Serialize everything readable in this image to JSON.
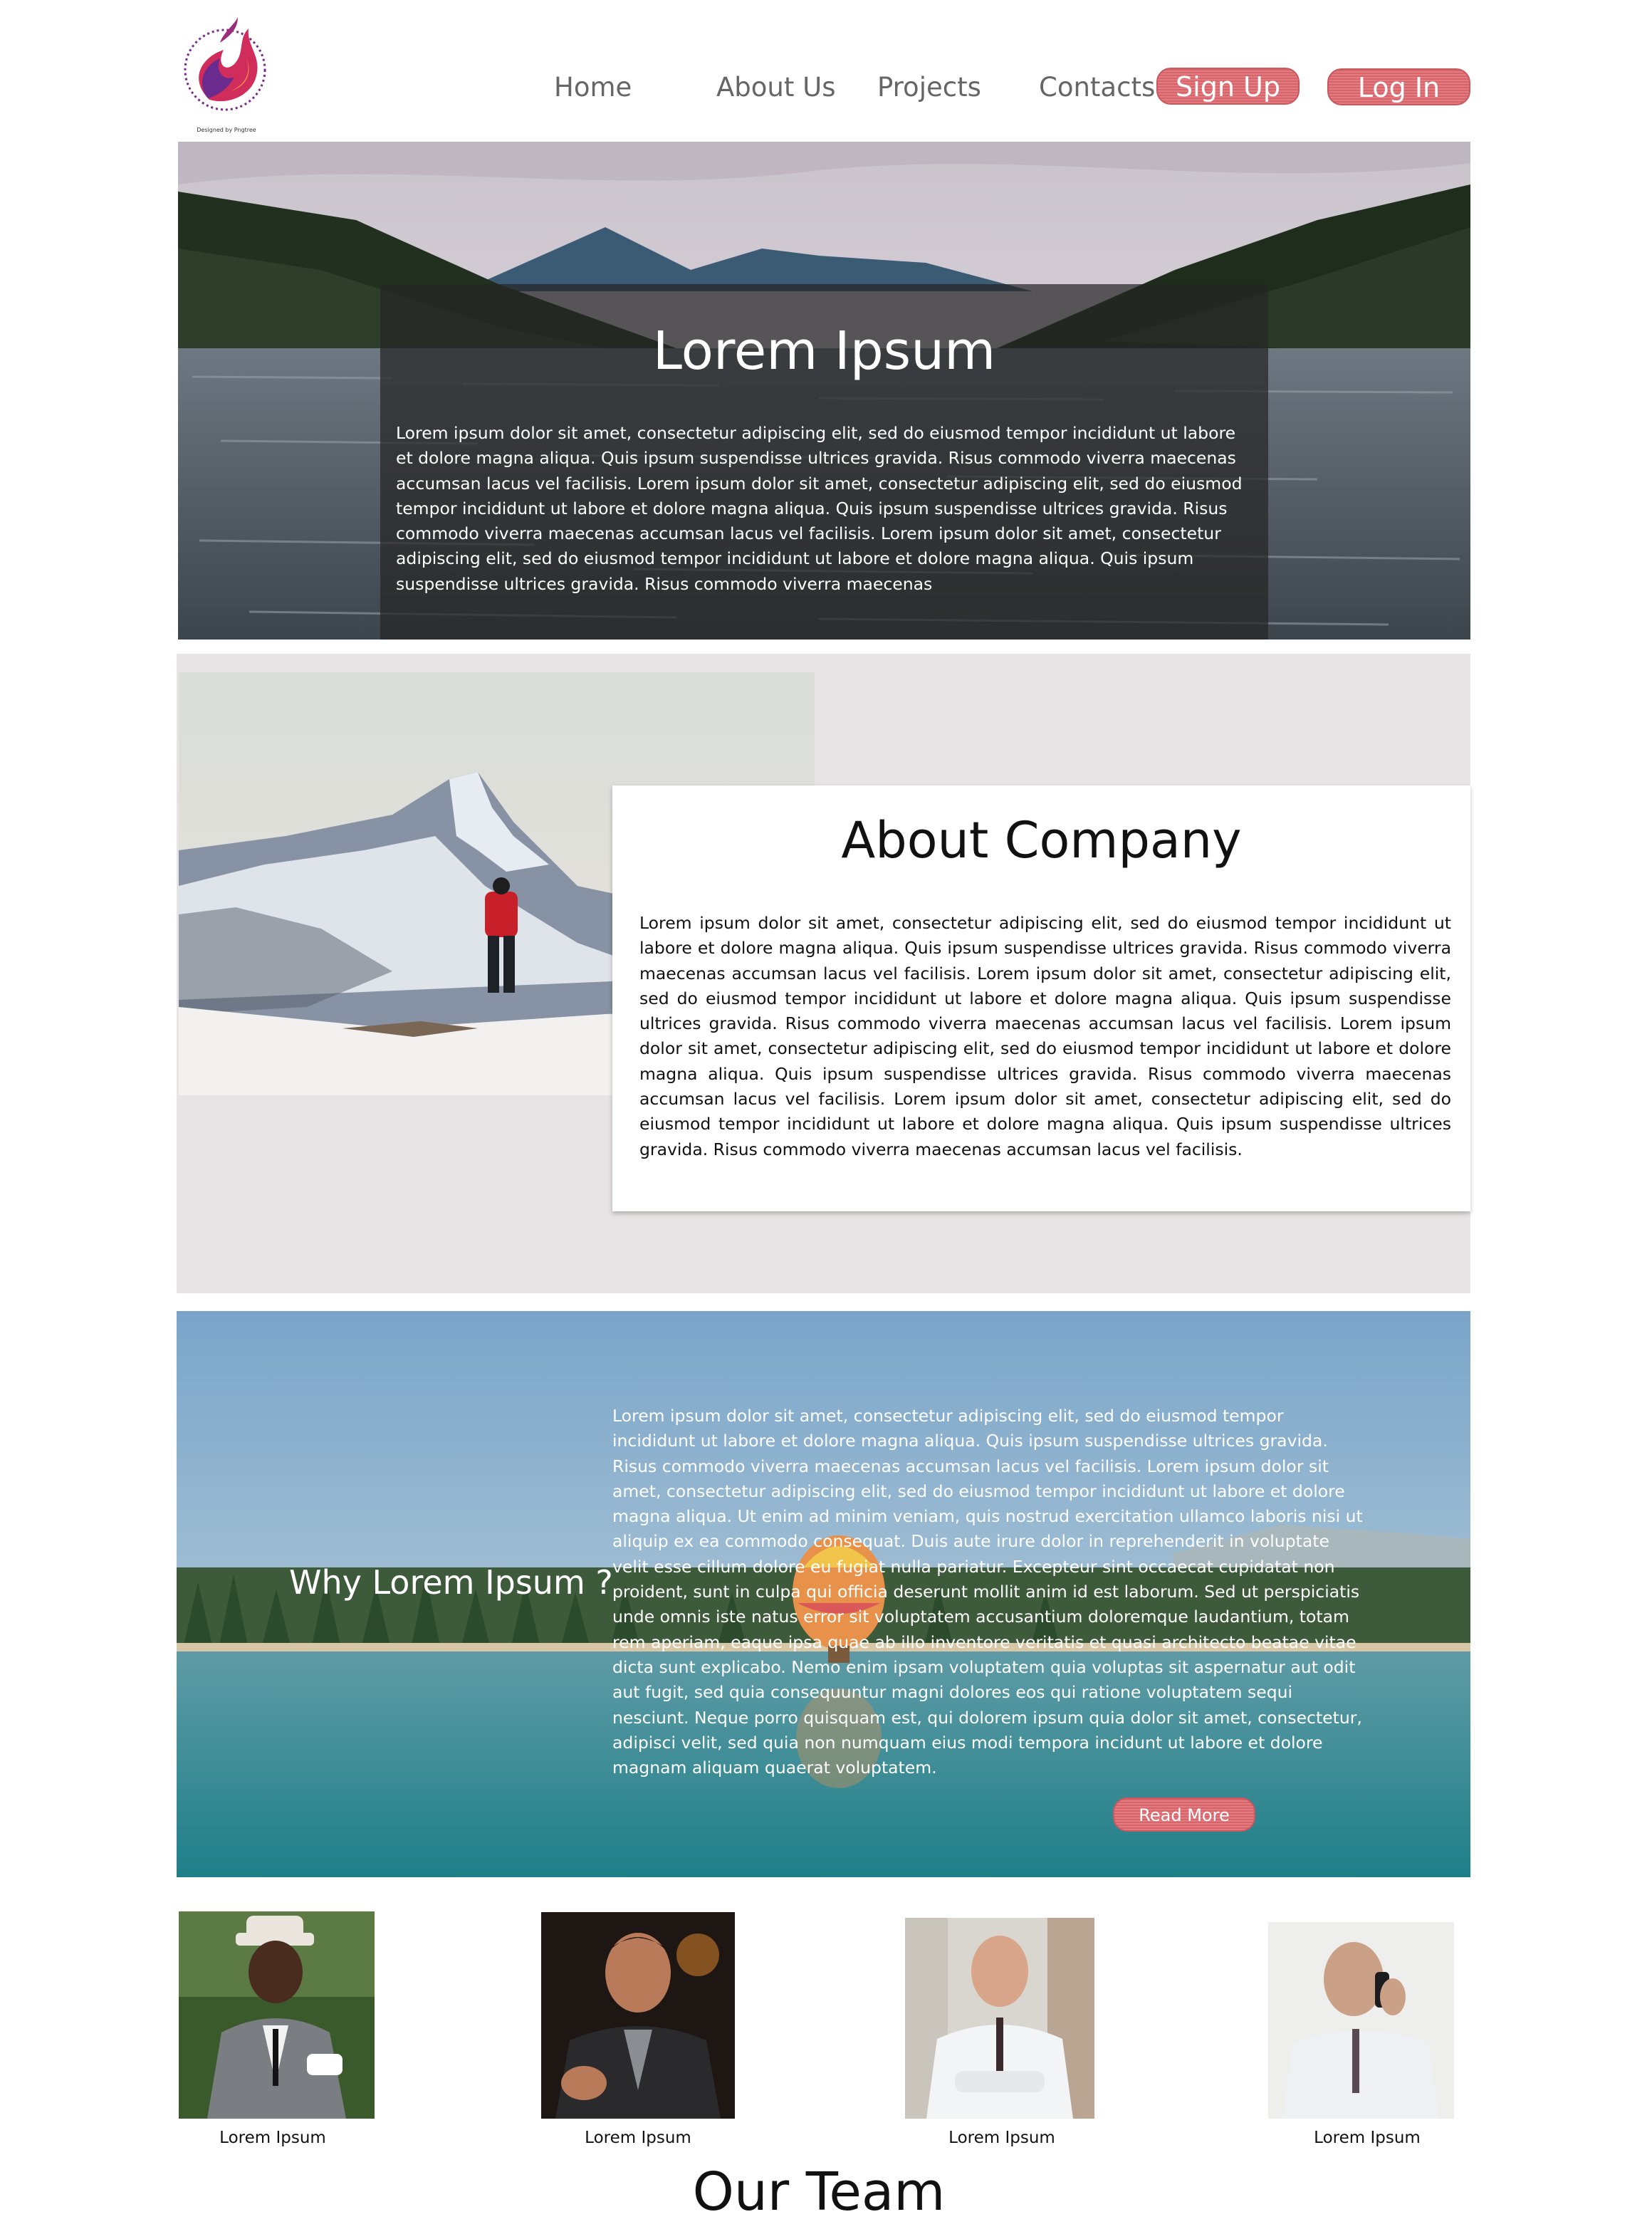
{
  "header": {
    "logo_caption": "Designed by Pngtree",
    "nav": [
      "Home",
      "About Us",
      "Projects",
      "Contacts"
    ],
    "signup_label": "Sign Up",
    "login_label": "Log In"
  },
  "hero": {
    "title": "Lorem Ipsum",
    "text": "Lorem ipsum dolor sit amet, consectetur adipiscing elit, sed do eiusmod tempor incididunt ut labore et dolore magna aliqua. Quis ipsum suspendisse ultrices gravida. Risus commodo viverra maecenas accumsan lacus vel facilisis. Lorem ipsum dolor sit amet, consectetur adipiscing elit, sed do eiusmod tempor incididunt ut labore et dolore magna aliqua. Quis ipsum suspendisse ultrices gravida. Risus commodo viverra maecenas accumsan lacus vel facilisis. Lorem ipsum dolor sit amet, consectetur adipiscing elit, sed do eiusmod tempor incididunt ut labore et dolore magna aliqua. Quis ipsum suspendisse ultrices gravida. Risus commodo viverra maecenas"
  },
  "about": {
    "title": "About Company",
    "text": "Lorem ipsum dolor sit amet, consectetur adipiscing elit, sed do eiusmod tempor incididunt ut labore et dolore magna aliqua. Quis ipsum suspendisse ultrices gravida. Risus commodo viverra maecenas accumsan lacus vel facilisis. Lorem ipsum dolor sit amet, consectetur adipiscing elit, sed do eiusmod tempor incididunt ut labore et dolore magna aliqua. Quis ipsum suspendisse ultrices gravida. Risus commodo viverra maecenas accumsan lacus vel facilisis. Lorem ipsum dolor sit amet, consectetur adipiscing elit, sed do eiusmod tempor incididunt ut labore et dolore magna aliqua. Quis ipsum suspendisse ultrices gravida. Risus commodo viverra maecenas accumsan lacus vel facilisis. Lorem ipsum dolor sit amet, consectetur adipiscing elit, sed do eiusmod tempor incididunt ut labore et dolore magna aliqua. Quis ipsum suspendisse ultrices gravida. Risus commodo viverra maecenas accumsan lacus vel facilisis."
  },
  "why": {
    "title": "Why Lorem Ipsum ?",
    "text": "Lorem ipsum dolor sit amet, consectetur adipiscing elit, sed do eiusmod tempor incididunt ut labore et dolore magna aliqua. Quis ipsum suspendisse ultrices gravida. Risus commodo viverra maecenas accumsan lacus vel facilisis. Lorem ipsum dolor sit amet, consectetur adipiscing elit, sed do eiusmod tempor incididunt ut labore et dolore magna aliqua. Ut enim ad minim veniam, quis nostrud exercitation ullamco laboris nisi ut aliquip ex ea commodo consequat. Duis aute irure dolor in reprehenderit in voluptate velit esse cillum dolore eu fugiat nulla pariatur. Excepteur sint occaecat cupidatat non proident, sunt in culpa qui officia deserunt mollit anim id est laborum. Sed ut perspiciatis unde omnis iste natus error sit voluptatem accusantium doloremque laudantium, totam rem aperiam, eaque ipsa quae ab illo inventore veritatis et quasi architecto beatae vitae dicta sunt explicabo. Nemo enim ipsam voluptatem quia voluptas sit aspernatur aut odit aut fugit, sed quia consequuntur magni dolores eos qui ratione voluptatem sequi nesciunt. Neque porro quisquam est, qui dolorem ipsum quia dolor sit amet, consectetur, adipisci velit, sed quia non numquam eius modi tempora incidunt ut labore et dolore magnam aliquam quaerat voluptatem.",
    "button_label": "Read More"
  },
  "team": {
    "title": "Our Team",
    "members": [
      {
        "name": "Lorem Ipsum"
      },
      {
        "name": "Lorem Ipsum"
      },
      {
        "name": "Lorem Ipsum"
      },
      {
        "name": "Lorem Ipsum"
      }
    ]
  },
  "colors": {
    "button": "#dc6c72",
    "about_bg": "#e8e4e5",
    "hero_overlay": "#262626"
  }
}
